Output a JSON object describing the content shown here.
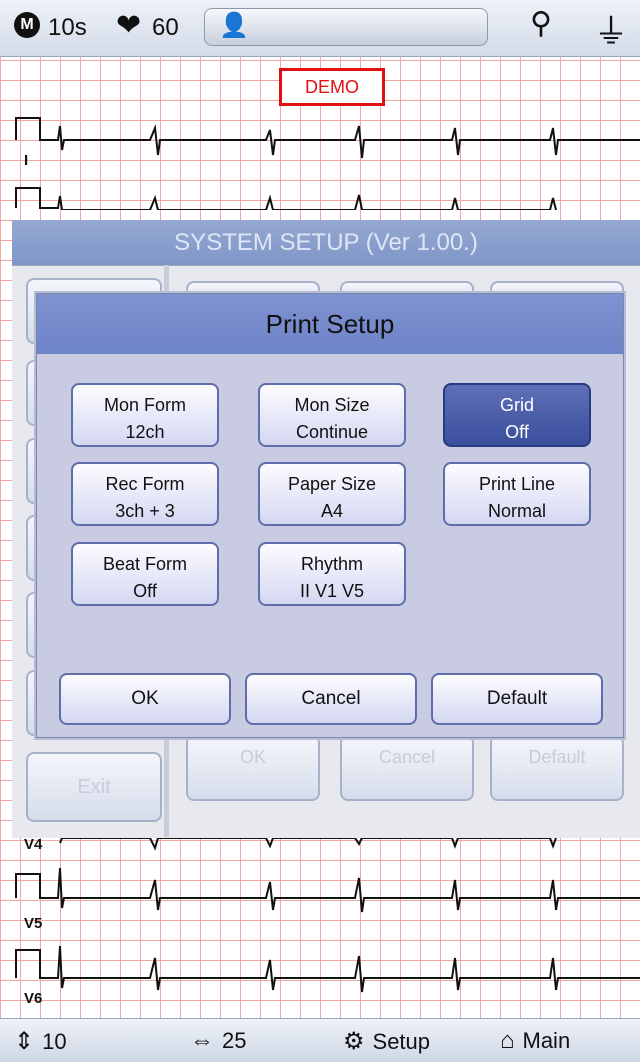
{
  "status_bar": {
    "mode_icon": "M",
    "duration": "10s",
    "heart_rate": "60",
    "icons": [
      "mode-icon",
      "heart-icon",
      "person-icon",
      "usb-icon",
      "power-plug-icon"
    ]
  },
  "demo_label": "DEMO",
  "leads": [
    "I",
    "V4",
    "V5",
    "V6"
  ],
  "system_setup": {
    "title": "SYSTEM SETUP (Ver 1.00.)",
    "side_exit_label": "Exit",
    "bg_ok": "OK",
    "bg_cancel": "Cancel",
    "bg_default": "Default"
  },
  "print_setup": {
    "title": "Print Setup",
    "options": [
      {
        "label": "Mon Form",
        "value": "12ch",
        "active": false
      },
      {
        "label": "Mon Size",
        "value": "Continue",
        "active": false
      },
      {
        "label": "Grid",
        "value": "Off",
        "active": true
      },
      {
        "label": "Rec Form",
        "value": "3ch + 3",
        "active": false
      },
      {
        "label": "Paper Size",
        "value": "A4",
        "active": false
      },
      {
        "label": "Print Line",
        "value": "Normal",
        "active": false
      },
      {
        "label": "Beat Form",
        "value": "Off",
        "active": false
      },
      {
        "label": "Rhythm",
        "value": "II  V1  V5",
        "active": false
      }
    ],
    "ok_label": "OK",
    "cancel_label": "Cancel",
    "default_label": "Default"
  },
  "bottom_bar": {
    "sensitivity_value": "10",
    "speed_value": "25",
    "setup_label": "Setup",
    "main_label": "Main"
  },
  "colors": {
    "grid": "#f1a6a6",
    "dialog_header": "#7389cb",
    "active_button": "#4a5ca8",
    "demo_red": "#e01010"
  }
}
